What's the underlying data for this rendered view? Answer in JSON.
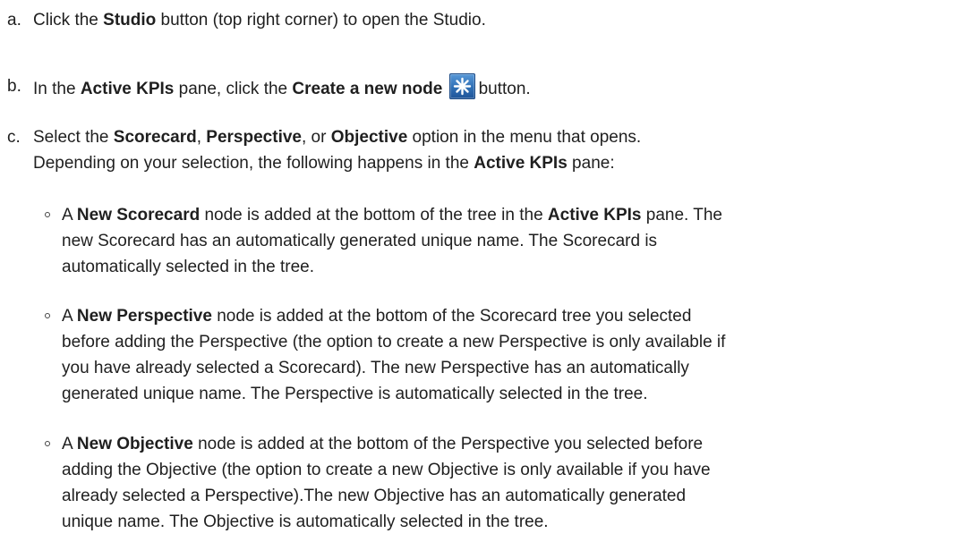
{
  "steps": [
    {
      "marker": "a.",
      "parts": [
        {
          "text": "Click the ",
          "bold": false
        },
        {
          "text": "Studio",
          "bold": true
        },
        {
          "text": " button (top right corner) to open the Studio.",
          "bold": false
        }
      ]
    },
    {
      "marker": "b.",
      "parts": [
        {
          "text": "In the ",
          "bold": false
        },
        {
          "text": "Active KPIs",
          "bold": true
        },
        {
          "text": " pane, click the ",
          "bold": false
        },
        {
          "text": "Create a new node",
          "bold": true
        },
        {
          "icon": "create-node-icon"
        },
        {
          "text": "button.",
          "bold": false
        }
      ]
    },
    {
      "marker": "c.",
      "parts": [
        {
          "text": "Select the ",
          "bold": false
        },
        {
          "text": "Scorecard",
          "bold": true
        },
        {
          "text": ", ",
          "bold": false
        },
        {
          "text": "Perspective",
          "bold": true
        },
        {
          "text": ", or ",
          "bold": false
        },
        {
          "text": "Objective",
          "bold": true
        },
        {
          "text": " option in the menu that opens.",
          "bold": false
        },
        {
          "break": true
        },
        {
          "text": "Depending on your selection, the following happens in the ",
          "bold": false
        },
        {
          "text": "Active KPIs",
          "bold": true
        },
        {
          "text": " pane:",
          "bold": false
        }
      ]
    }
  ],
  "bullets": [
    {
      "lines": [
        [
          {
            "text": "A ",
            "bold": false
          },
          {
            "text": "New Scorecard",
            "bold": true
          },
          {
            "text": " node is added at the bottom of the tree in the ",
            "bold": false
          },
          {
            "text": "Active KPIs",
            "bold": true
          },
          {
            "text": " pane. The",
            "bold": false
          }
        ],
        [
          {
            "text": "new Scorecard has an automatically generated unique name. The Scorecard is",
            "bold": false
          }
        ],
        [
          {
            "text": "automatically selected in the tree.",
            "bold": false
          }
        ]
      ]
    },
    {
      "lines": [
        [
          {
            "text": "A ",
            "bold": false
          },
          {
            "text": "New Perspective",
            "bold": true
          },
          {
            "text": " node is added at the bottom of the Scorecard tree you selected",
            "bold": false
          }
        ],
        [
          {
            "text": "before adding the Perspective (the option to create a new Perspective is only available if",
            "bold": false
          }
        ],
        [
          {
            "text": "you have already selected a Scorecard). The new Perspective has an automatically",
            "bold": false
          }
        ],
        [
          {
            "text": "generated unique name. The Perspective is automatically selected in the tree.",
            "bold": false
          }
        ]
      ]
    },
    {
      "lines": [
        [
          {
            "text": "A ",
            "bold": false
          },
          {
            "text": "New Objective",
            "bold": true
          },
          {
            "text": " node is added at the bottom of the Perspective you selected before",
            "bold": false
          }
        ],
        [
          {
            "text": "adding the Objective (the option to create a new Objective is only available if you have",
            "bold": false
          }
        ],
        [
          {
            "text": "already selected a Perspective).The new Objective has an automatically generated",
            "bold": false
          }
        ],
        [
          {
            "text": "unique name. The Objective is automatically selected in the tree.",
            "bold": false
          }
        ]
      ]
    }
  ]
}
